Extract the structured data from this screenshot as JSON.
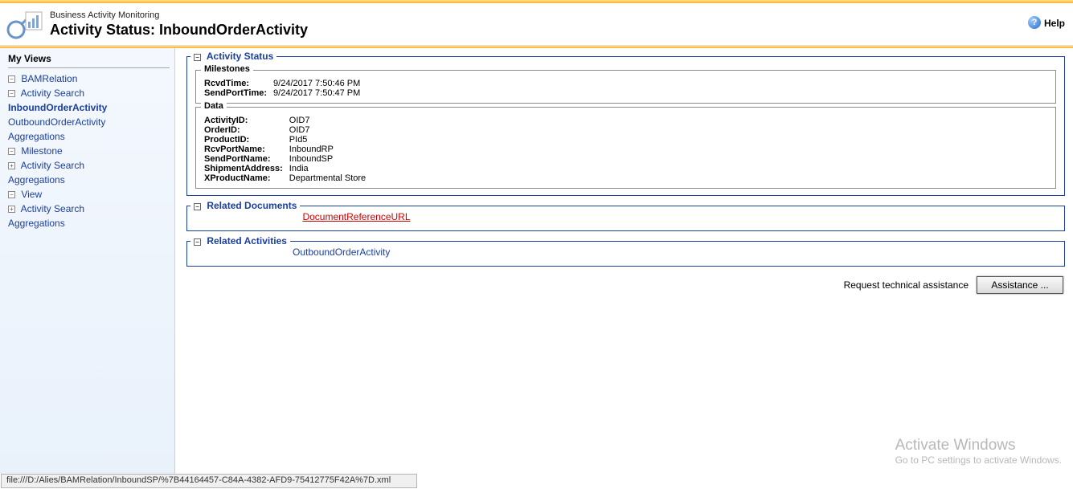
{
  "header": {
    "app_title": "Business Activity Monitoring",
    "page_title": "Activity Status: InboundOrderActivity",
    "help_label": "Help"
  },
  "sidebar": {
    "heading": "My Views",
    "nodes": {
      "bamrelation": "BAMRelation",
      "activity_search_1": "Activity Search",
      "inbound": "InboundOrderActivity",
      "outbound": "OutboundOrderActivity",
      "aggregations_1": "Aggregations",
      "milestone": "Milestone",
      "activity_search_2": "Activity Search",
      "aggregations_2": "Aggregations",
      "view": "View",
      "activity_search_3": "Activity Search",
      "aggregations_3": "Aggregations"
    }
  },
  "activity_status": {
    "legend": "Activity Status",
    "milestones": {
      "legend": "Milestones",
      "rows": {
        "RcvdTime": "9/24/2017 7:50:46 PM",
        "SendPortTime": "9/24/2017 7:50:47 PM"
      }
    },
    "data": {
      "legend": "Data",
      "rows": {
        "ActivityID": "OID7",
        "OrderID": "OID7",
        "ProductID": "PId5",
        "RcvPortName": "InboundRP",
        "SendPortName": "InboundSP",
        "ShipmentAddress": "India",
        "XProductName": "Departmental Store"
      }
    }
  },
  "related_documents": {
    "legend": "Related Documents",
    "link": "DocumentReferenceURL"
  },
  "related_activities": {
    "legend": "Related Activities",
    "link": "OutboundOrderActivity"
  },
  "assistance": {
    "label": "Request technical assistance",
    "button": "Assistance ..."
  },
  "activate_windows": {
    "title": "Activate Windows",
    "sub": "Go to PC settings to activate Windows."
  },
  "statusbar": "file:///D:/Alies/BAMRelation/InboundSP/%7B44164457-C84A-4382-AFD9-75412775F42A%7D.xml"
}
